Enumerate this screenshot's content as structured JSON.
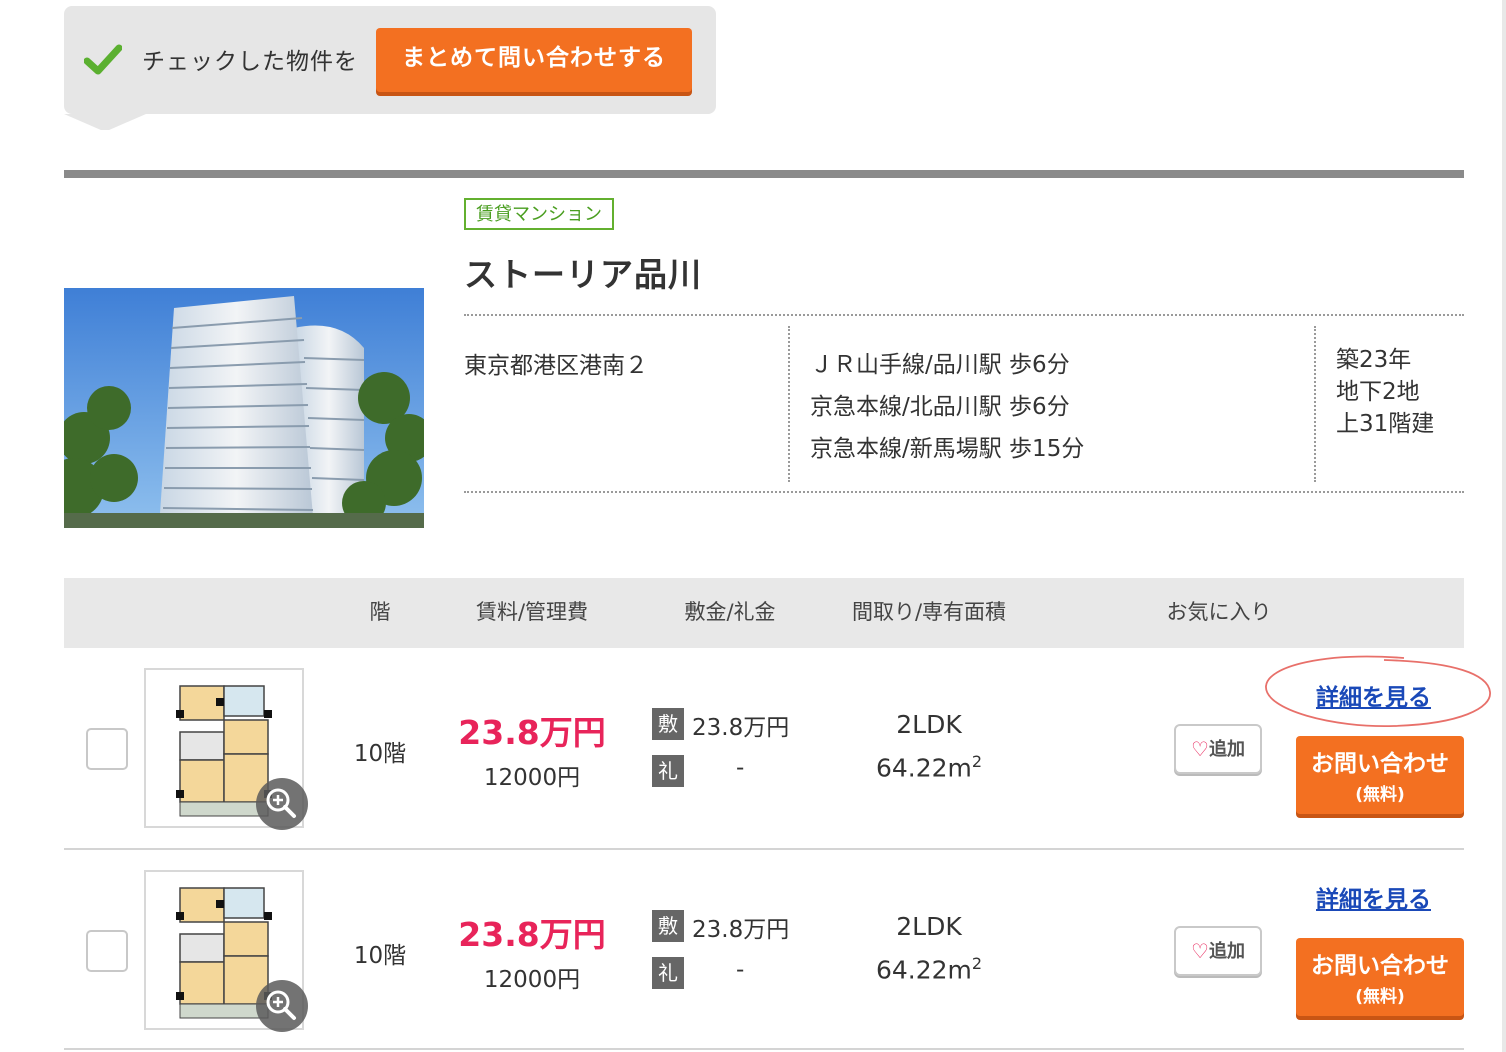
{
  "bulk_bar": {
    "label": "チェックした物件を",
    "button": "まとめて問い合わせする"
  },
  "property": {
    "type_badge": "賃貸マンション",
    "name": "ストーリア品川",
    "address": "東京都港区港南２",
    "access": [
      "ＪＲ山手線/品川駅 歩6分",
      "京急本線/北品川駅 歩6分",
      "京急本線/新馬場駅 歩15分"
    ],
    "building": [
      "築23年",
      "地下2地",
      "上31階建"
    ]
  },
  "table": {
    "headers": {
      "floor": "階",
      "rent": "賃料/管理費",
      "deposit": "敷金/礼金",
      "layout": "間取り/専有面積",
      "favorite": "お気に入り"
    }
  },
  "rooms": [
    {
      "floor": "10階",
      "rent": "23.8万円",
      "fee": "12000円",
      "deposit_label": "敷",
      "deposit": "23.8万円",
      "key_money_label": "礼",
      "key_money": "-",
      "layout": "2LDK",
      "area": "64.22m",
      "area_unit_sup": "2",
      "fav_label": "追加",
      "detail_link": "詳細を見る",
      "contact_main": "お問い合わせ",
      "contact_sub": "(無料)"
    },
    {
      "floor": "10階",
      "rent": "23.8万円",
      "fee": "12000円",
      "deposit_label": "敷",
      "deposit": "23.8万円",
      "key_money_label": "礼",
      "key_money": "-",
      "layout": "2LDK",
      "area": "64.22m",
      "area_unit_sup": "2",
      "fav_label": "追加",
      "detail_link": "詳細を見る",
      "contact_main": "お問い合わせ",
      "contact_sub": "(無料)"
    }
  ],
  "colors": {
    "accent_orange": "#f37021",
    "price_pink": "#e8245a",
    "link_blue": "#1a49b8",
    "badge_green": "#63b02f",
    "annotation_red": "#e8706a"
  }
}
